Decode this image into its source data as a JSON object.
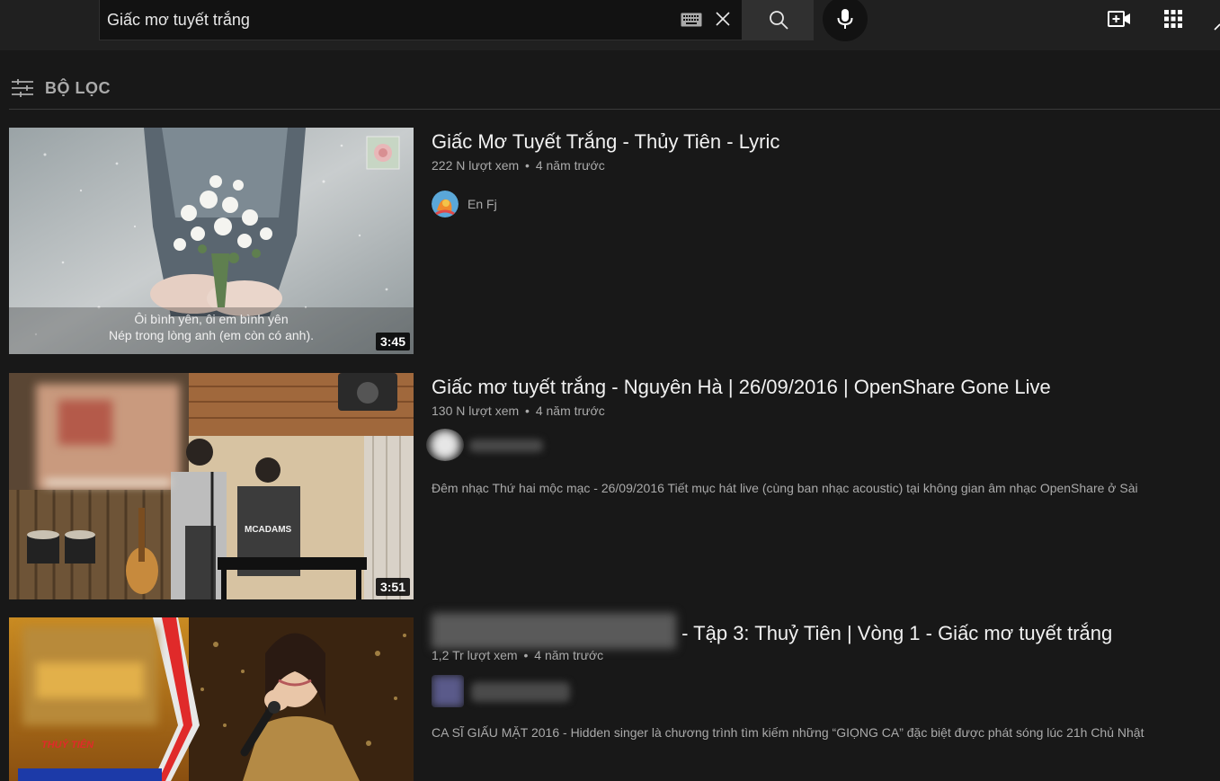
{
  "search": {
    "query": "Giấc mơ tuyết trắng"
  },
  "filter": {
    "label": "BỘ LỌC"
  },
  "results": [
    {
      "title": "Giấc Mơ Tuyết Trắng - Thủy Tiên - Lyric",
      "views": "222 N lượt xem",
      "age": "4 năm trước",
      "channel": "En Fj",
      "duration": "3:45",
      "thumb_caption_line1": "Ôi bình yên, ôi em bình yên",
      "thumb_caption_line2": "Nép trong lòng anh (em còn có anh)."
    },
    {
      "title": "Giấc mơ tuyết trắng - Nguyên Hà | 26/09/2016 | OpenShare Gone Live",
      "views": "130 N lượt xem",
      "age": "4 năm trước",
      "description": "Đêm nhạc Thứ hai mộc mạc - 26/09/2016 Tiết mục hát live (cùng ban nhạc acoustic) tại không gian âm nhạc OpenShare ở Sài",
      "duration": "3:51",
      "thumb_shirt_text": "MCADAMS"
    },
    {
      "title_suffix": "- Tập 3: Thuỷ Tiên | Vòng 1 - Giấc mơ tuyết trắng",
      "views": "1,2 Tr lượt xem",
      "age": "4 năm trước",
      "description": "CA SĨ GIẤU MẶT 2016 - Hidden singer là chương trình tìm kiếm những “GIỌNG CA” đặc biệt được phát sóng lúc 21h Chủ Nhật",
      "thumb_name_tag": "THUỶ TIÊN"
    }
  ],
  "meta_separator": "•"
}
